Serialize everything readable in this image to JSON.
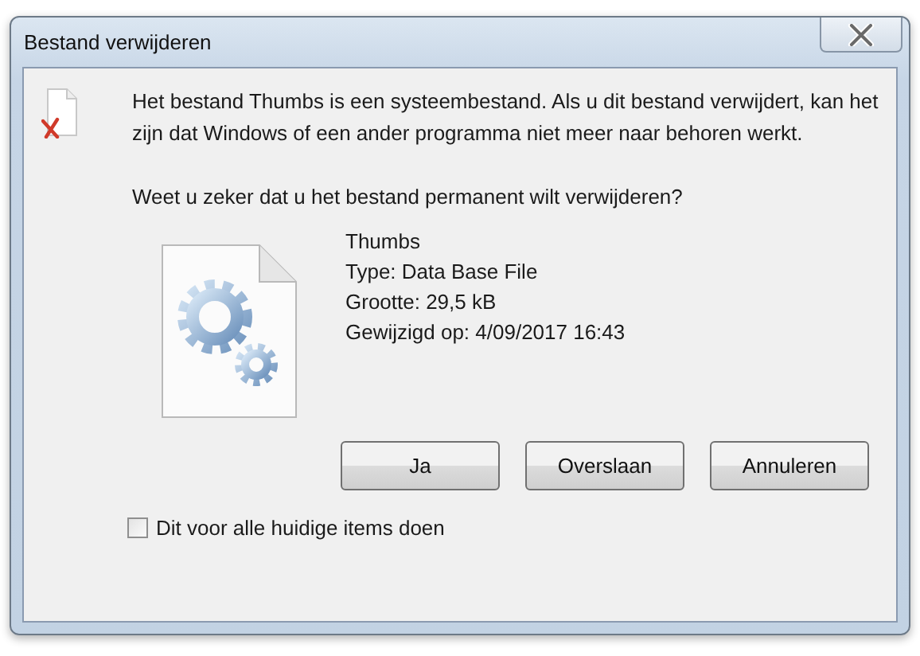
{
  "window": {
    "title": "Bestand verwijderen"
  },
  "message": "Het bestand Thumbs is een systeembestand. Als u dit bestand verwijdert, kan het zijn dat Windows of een ander programma niet meer naar behoren werkt.",
  "question": "Weet u zeker dat u het bestand permanent wilt verwijderen?",
  "file": {
    "name": "Thumbs",
    "details": [
      "Type: Data Base File",
      "Grootte: 29,5 kB",
      "Gewijzigd op: 4/09/2017 16:43"
    ]
  },
  "buttons": [
    "Ja",
    "Overslaan",
    "Annuleren"
  ],
  "checkbox": {
    "label": "Dit voor alle huidige items doen",
    "checked": false
  }
}
